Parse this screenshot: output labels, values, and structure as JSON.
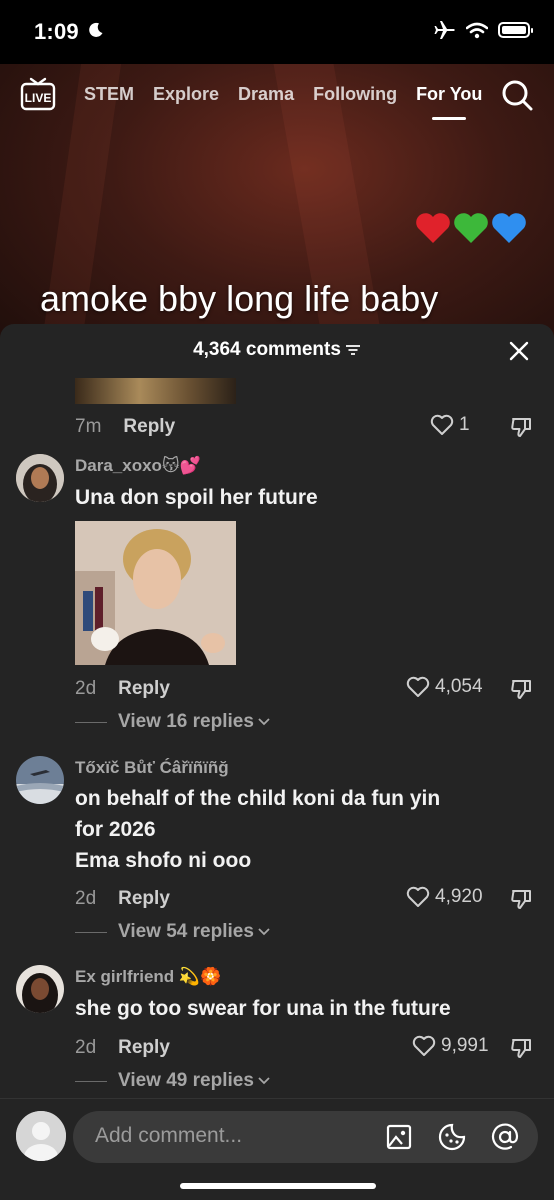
{
  "status_bar": {
    "time": "1:09"
  },
  "nav": {
    "tabs": [
      "STEM",
      "Explore",
      "Drama",
      "Following",
      "For You"
    ],
    "active_tab": "For You"
  },
  "video": {
    "caption": "amoke bby long life baby"
  },
  "comments": {
    "count_label": "4,364 comments",
    "first_meta": {
      "time": "7m",
      "reply": "Reply",
      "likes": "1"
    },
    "items": [
      {
        "username": "Dara_xoxo😽💕",
        "lines": [
          "Una don spoil her future"
        ],
        "time": "2d",
        "reply": "Reply",
        "likes": "4,054",
        "view_replies": "View 16 replies"
      },
      {
        "username": "Tőxïč Bůť Ćâřïñïñğ",
        "lines": [
          "on behalf of the child koni da fun yin",
          "for 2026",
          "Ema shofo ni ooo"
        ],
        "time": "2d",
        "reply": "Reply",
        "likes": "4,920",
        "view_replies": "View 54 replies"
      },
      {
        "username": "Ex girlfriend 💫🏵️",
        "lines": [
          "she go too swear for una in the future"
        ],
        "time": "2d",
        "reply": "Reply",
        "likes": "9,991",
        "view_replies": "View 49 replies"
      }
    ]
  },
  "input": {
    "placeholder": "Add comment..."
  },
  "colors": {
    "sheet_bg": "#242424",
    "heart_red": "#e0222b",
    "heart_green": "#3db83a",
    "heart_blue": "#2f8ff0"
  }
}
